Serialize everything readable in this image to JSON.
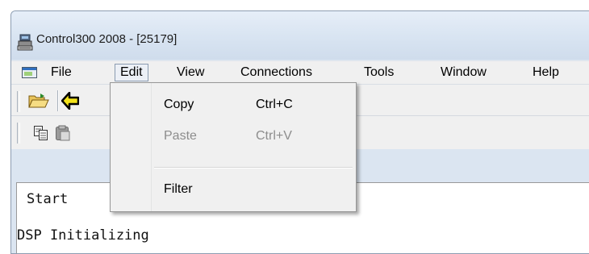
{
  "window": {
    "title": "Control300 2008 - [25179]"
  },
  "menubar": {
    "items": [
      {
        "label": "File"
      },
      {
        "label": "Edit"
      },
      {
        "label": "View"
      },
      {
        "label": "Connections"
      },
      {
        "label": "Tools"
      },
      {
        "label": "Window"
      },
      {
        "label": "Help"
      }
    ],
    "active": "Edit"
  },
  "edit_menu": {
    "items": [
      {
        "label": "Copy",
        "shortcut": "Ctrl+C",
        "enabled": true
      },
      {
        "label": "Paste",
        "shortcut": "Ctrl+V",
        "enabled": false
      },
      {
        "label": "Filter",
        "shortcut": "",
        "enabled": true
      }
    ]
  },
  "toolbar": {
    "row1_icons": [
      "open-folder-icon",
      "back-arrow-icon"
    ],
    "row2_icons": [
      "copy-icon",
      "paste-icon"
    ]
  },
  "content": {
    "line1": "Start",
    "line2": "DSP Initializing"
  },
  "colors": {
    "menu_bg": "#f0f0f0",
    "title_bg": "#dbe5f1",
    "disabled_text": "#8d8d8d"
  }
}
